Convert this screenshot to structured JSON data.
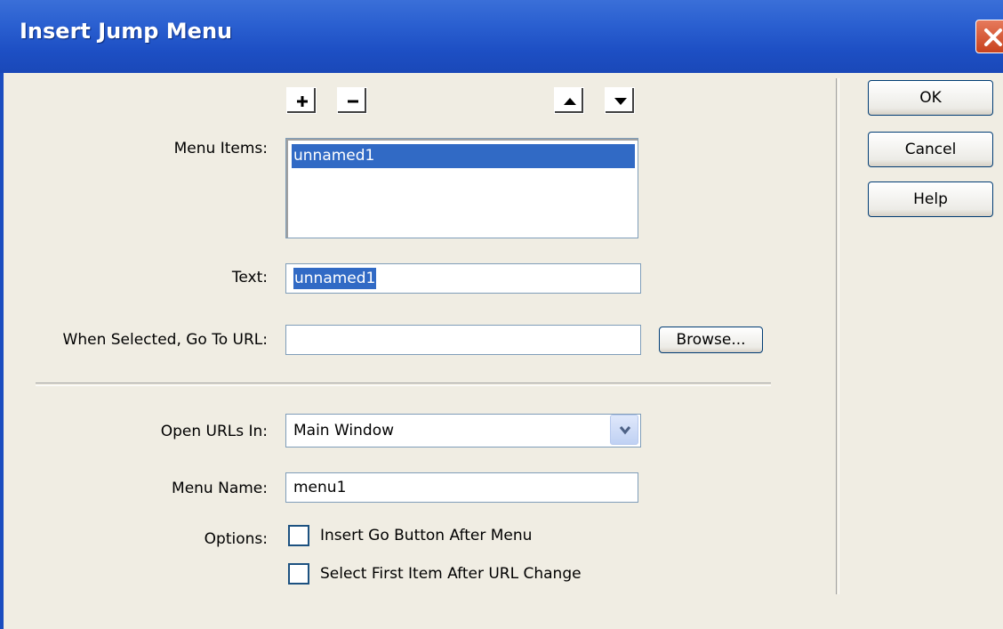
{
  "window": {
    "title": "Insert Jump Menu"
  },
  "toolbar": {
    "add_icon": "plus-icon",
    "remove_icon": "minus-icon",
    "up_icon": "arrow-up-icon",
    "down_icon": "arrow-down-icon"
  },
  "menu_items": {
    "label": "Menu Items:",
    "items": [
      "unnamed1"
    ]
  },
  "text": {
    "label": "Text:",
    "value": "unnamed1"
  },
  "url": {
    "label": "When Selected, Go To URL:",
    "value": "",
    "browse_label": "Browse..."
  },
  "open_in": {
    "label": "Open URLs In:",
    "selected": "Main Window"
  },
  "menu_name": {
    "label": "Menu Name:",
    "value": "menu1"
  },
  "options": {
    "label": "Options:",
    "go_button": {
      "label": "Insert Go Button After Menu",
      "checked": false
    },
    "select_first": {
      "label": "Select First Item After URL Change",
      "checked": false
    }
  },
  "buttons": {
    "ok": "OK",
    "cancel": "Cancel",
    "help": "Help"
  }
}
